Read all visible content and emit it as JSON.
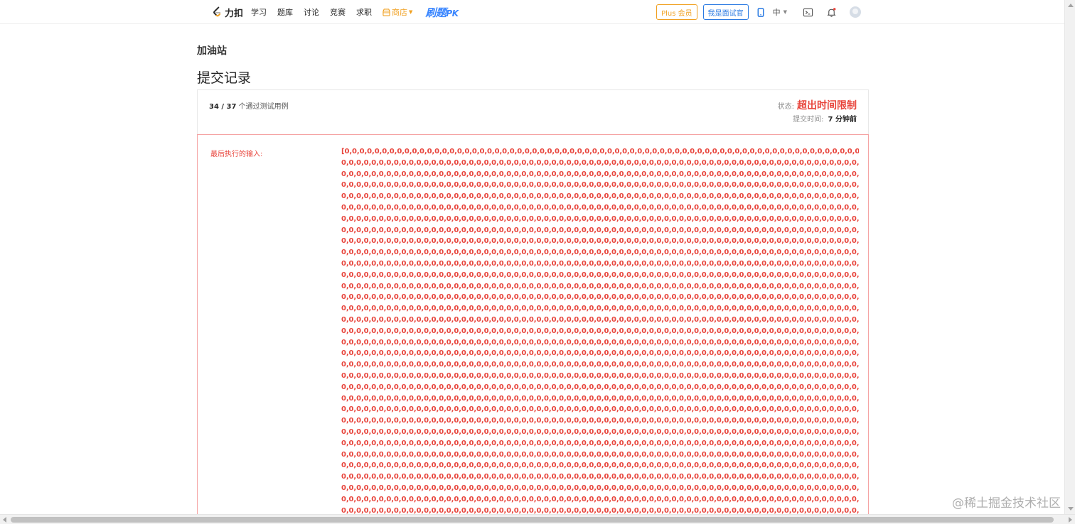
{
  "nav": {
    "logo_text": "力扣",
    "links": [
      "学习",
      "题库",
      "讨论",
      "竞赛",
      "求职"
    ],
    "store_label": "商店",
    "pk_label": "刷题",
    "pk_suffix": "PK",
    "plus_label": "Plus 会员",
    "interviewer_label": "我是面试官",
    "lang_label": "中",
    "icons": [
      "phone-icon",
      "terminal-icon",
      "bell-icon",
      "avatar"
    ]
  },
  "page": {
    "brand_title": "加油站",
    "title": "提交记录"
  },
  "result": {
    "passed_count": "34",
    "total_count": "37",
    "passed_text": "个通过测试用例",
    "status_label": "状态:",
    "status_value": "超出时间限制",
    "time_label": "提交时间:",
    "time_value": "7 分钟前"
  },
  "last_input": {
    "label": "最后执行的输入:",
    "first_line": "[0,0,0,0,0,0,0,0,0,0,0,0,0,0,0,0,0,0,0,0,0,0,0,0,0,0,0,0,0,0,0,0,0,0,0,0,0,0,0,0,0,0,0,0,0,0,0,0,0,0,0,0,0,0,0,0,0,0,0,0,0,0,0,0,0,0,0,0,0,0,0,0,0,0,0,0,0,0,0,0,0,0,0,0,0,0,0,0,0,0,",
    "repeat_line": "0,0,0,0,0,0,0,0,0,0,0,0,0,0,0,0,0,0,0,0,0,0,0,0,0,0,0,0,0,0,0,0,0,0,0,0,0,0,0,0,0,0,0,0,0,0,0,0,0,0,0,0,0,0,0,0,0,0,0,0,0,0,0,0,0,0,0,0,0,0,0,0,0,0,0,0,0,0,0,0,0,0,0,0,0,0,0,0,0,0,",
    "repeat_count": 33
  },
  "watermark": "@稀土掘金技术社区",
  "colors": {
    "error_red": "#e8453c",
    "plus_orange": "#f0a020",
    "primary_blue": "#2a7ae2"
  }
}
